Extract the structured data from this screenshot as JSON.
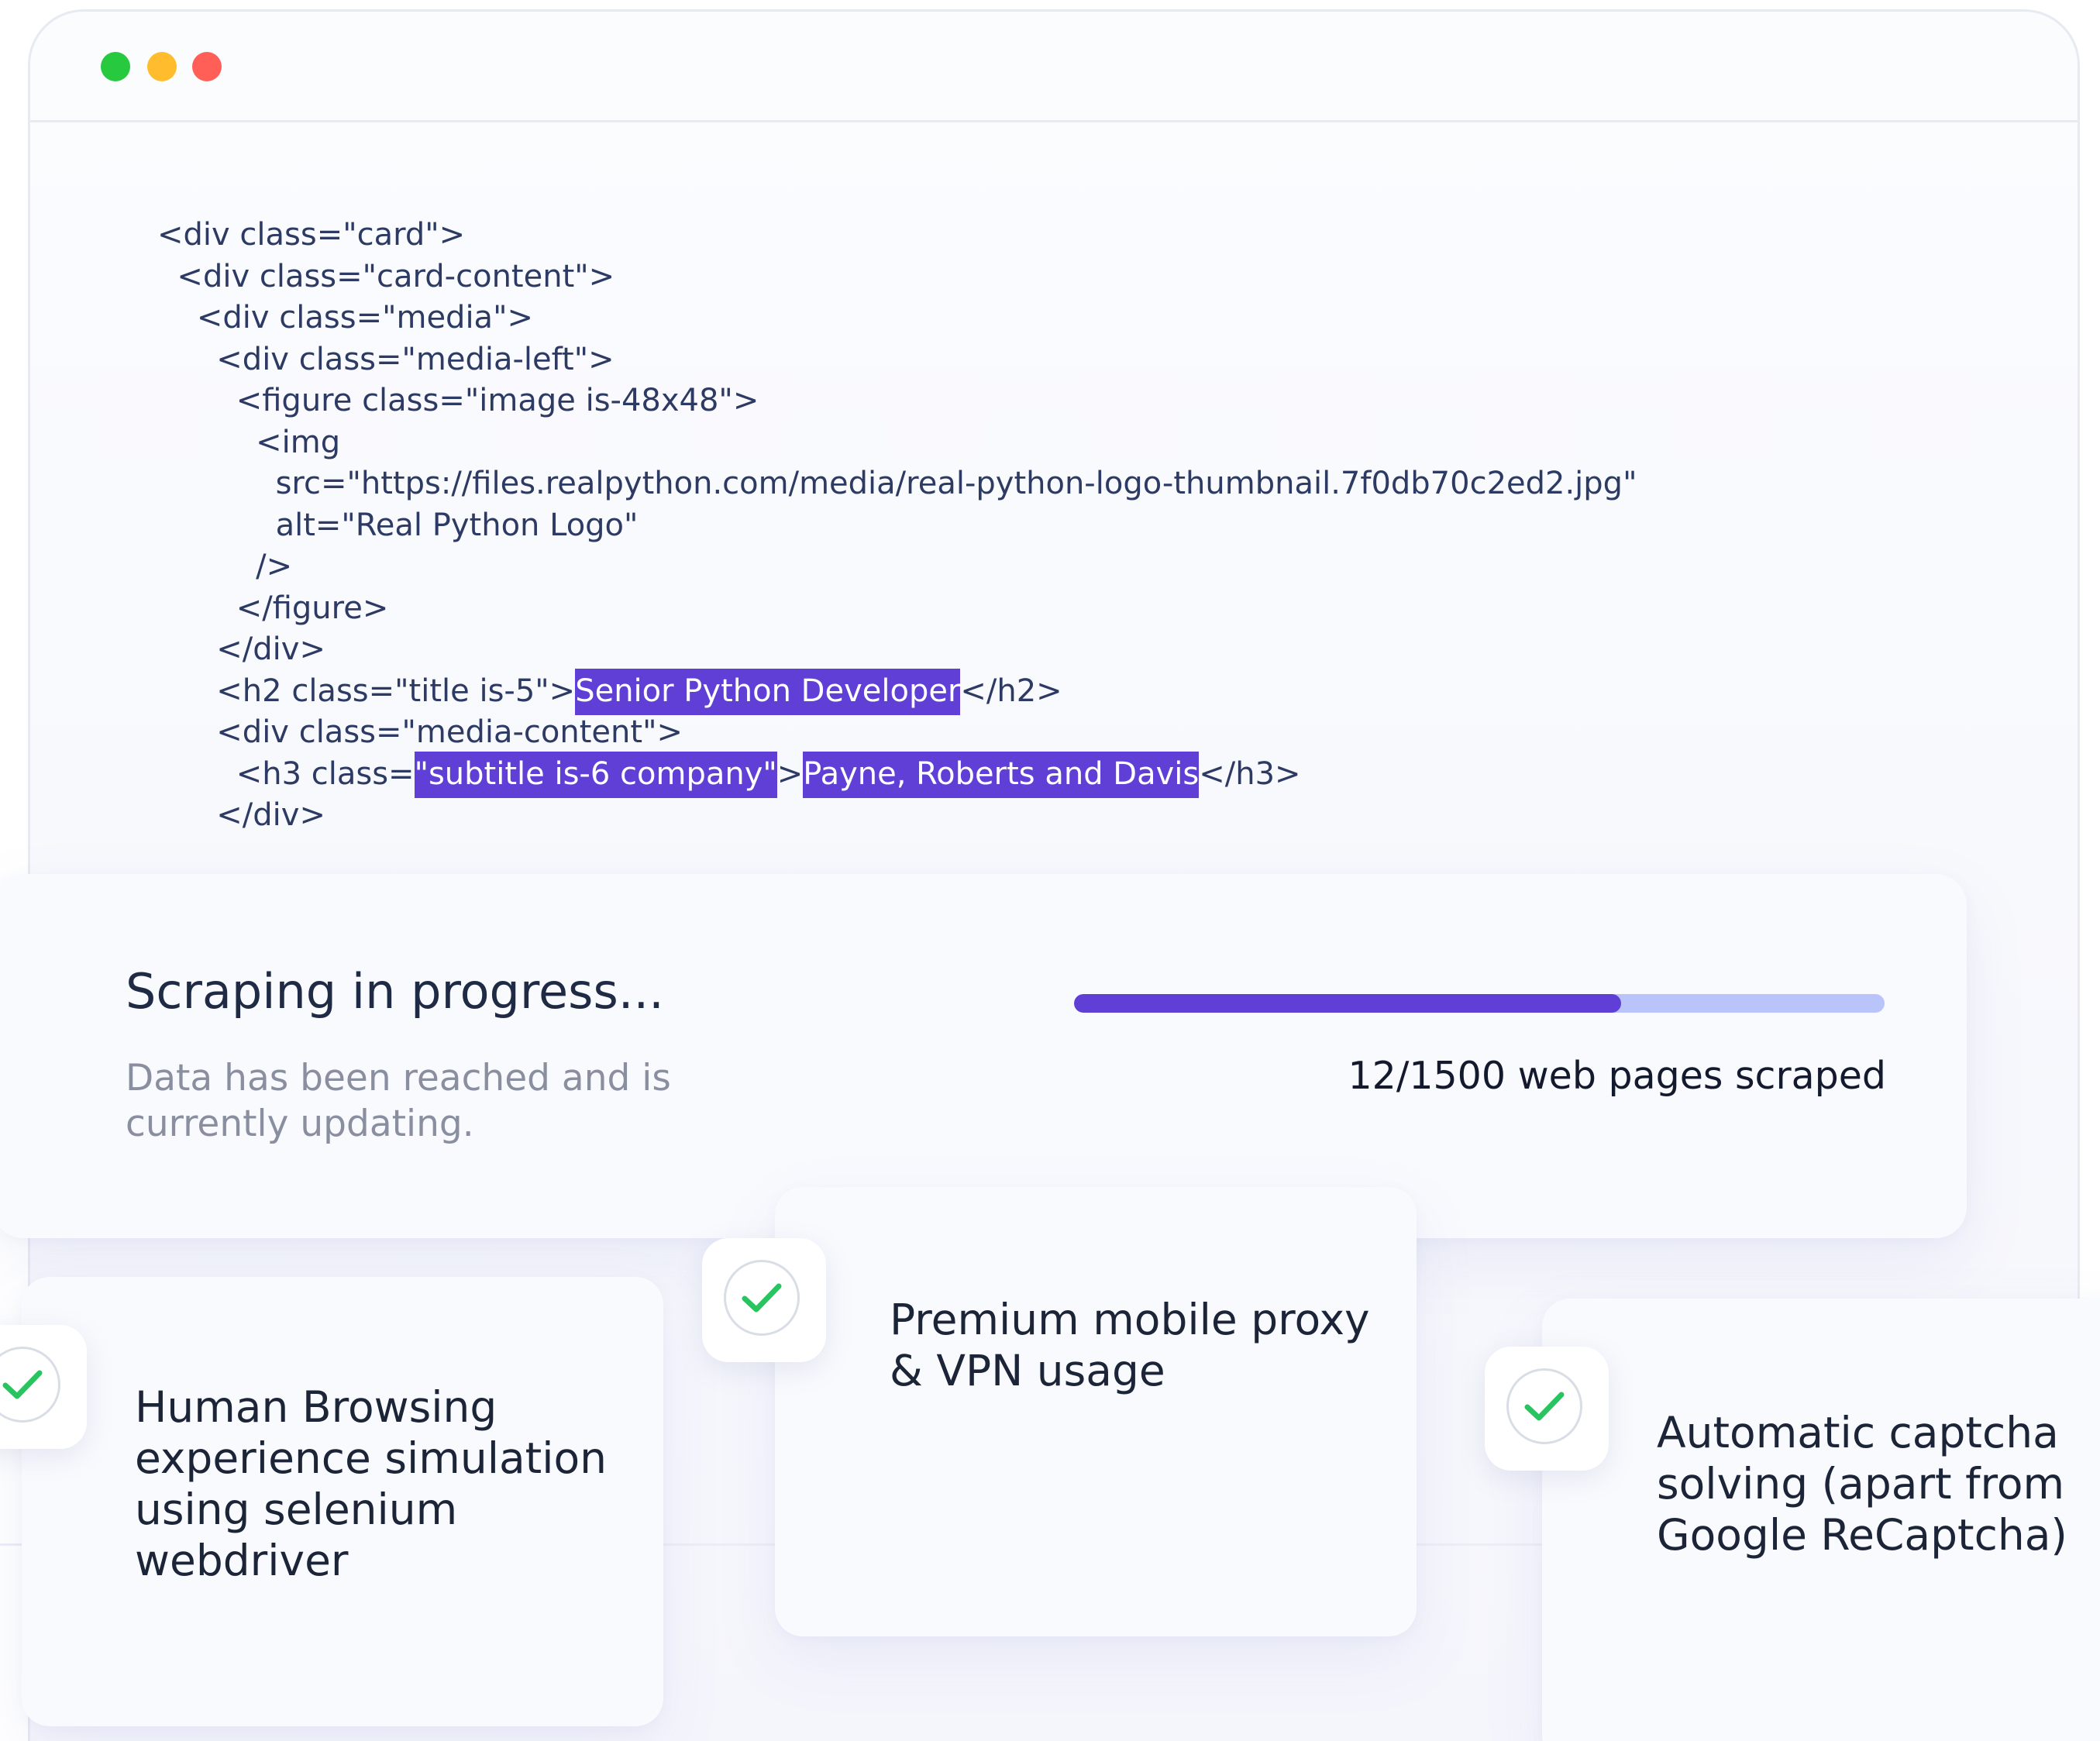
{
  "window": {
    "controls": [
      "green-dot",
      "yellow-dot",
      "red-dot"
    ],
    "control_colors": {
      "green": "#27c93f",
      "yellow": "#ffbd2e",
      "red": "#ff5f56"
    }
  },
  "code": {
    "lines": [
      {
        "parts": [
          {
            "text": "<div class=\"card\">",
            "hl": false
          }
        ]
      },
      {
        "parts": [
          {
            "text": "  <div class=\"card-content\">",
            "hl": false
          }
        ]
      },
      {
        "parts": [
          {
            "text": "    <div class=\"media\">",
            "hl": false
          }
        ]
      },
      {
        "parts": [
          {
            "text": "      <div class=\"media-left\">",
            "hl": false
          }
        ]
      },
      {
        "parts": [
          {
            "text": "        <figure class=\"image is-48x48\">",
            "hl": false
          }
        ]
      },
      {
        "parts": [
          {
            "text": "          <img",
            "hl": false
          }
        ]
      },
      {
        "parts": [
          {
            "text": "            src=\"https://files.realpython.com/media/real-python-logo-thumbnail.7f0db70c2ed2.jpg\"",
            "hl": false
          }
        ]
      },
      {
        "parts": [
          {
            "text": "            alt=\"Real Python Logo\"",
            "hl": false
          }
        ]
      },
      {
        "parts": [
          {
            "text": "          />",
            "hl": false
          }
        ]
      },
      {
        "parts": [
          {
            "text": "        </figure>",
            "hl": false
          }
        ]
      },
      {
        "parts": [
          {
            "text": "      </div>",
            "hl": false
          }
        ]
      },
      {
        "parts": [
          {
            "text": "      <h2 class=\"title is-5\">",
            "hl": false
          },
          {
            "text": "Senior Python Developer",
            "hl": true
          },
          {
            "text": "</h2>",
            "hl": false
          }
        ]
      },
      {
        "parts": [
          {
            "text": "      <div class=\"media-content\">",
            "hl": false
          }
        ]
      },
      {
        "parts": [
          {
            "text": "        <h3 class=",
            "hl": false
          },
          {
            "text": "\"subtitle is-6 company\"",
            "hl": true
          },
          {
            "text": ">",
            "hl": false
          },
          {
            "text": "Payne, Roberts and Davis",
            "hl": true
          },
          {
            "text": "</h3>",
            "hl": false
          }
        ]
      },
      {
        "parts": [
          {
            "text": "      </div>",
            "hl": false
          }
        ]
      }
    ],
    "highlight_color": "#5f3fd6"
  },
  "progress": {
    "title": "Scraping in progress...",
    "subtitle": "Data has been reached and is currently updating.",
    "count_label": "12/1500 web pages scraped",
    "bar_fill_fraction": 0.675,
    "bar_color": "#5f3fd6",
    "track_color": "#b9c4fb"
  },
  "features": [
    {
      "text": "Human Browsing experience simulation using selenium webdriver",
      "icon": "check-icon"
    },
    {
      "text": "Premium mobile proxy & VPN usage",
      "icon": "check-icon"
    },
    {
      "text": "Automatic captcha solving (apart from Google ReCaptcha)",
      "icon": "check-icon"
    }
  ],
  "colors": {
    "check": "#27c45f",
    "text_dark": "#1c2438",
    "text_muted": "#8a8fa0"
  }
}
